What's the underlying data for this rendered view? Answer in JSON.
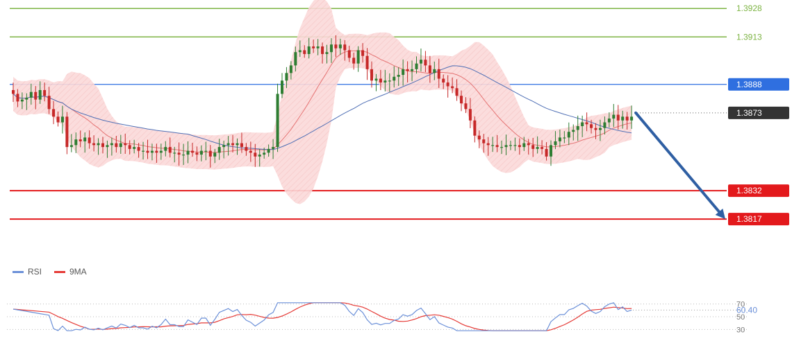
{
  "chart_data": [
    {
      "type": "candlestick",
      "title": "",
      "ylim": [
        1.3799,
        1.3931
      ],
      "grid": false,
      "current_price": {
        "value": 1.3873,
        "label": "1.3873",
        "color": "#333333"
      },
      "levels": [
        {
          "value": 1.3928,
          "label": "1.3928",
          "kind": "target",
          "color": "#7cb342"
        },
        {
          "value": 1.3913,
          "label": "1.3913",
          "kind": "target",
          "color": "#7cb342"
        },
        {
          "value": 1.3888,
          "label": "1.3888",
          "kind": "pivot",
          "color": "#2f6fe0"
        },
        {
          "value": 1.3832,
          "label": "1.3832",
          "kind": "support",
          "color": "#e3191c"
        },
        {
          "value": 1.3817,
          "label": "1.3817",
          "kind": "support",
          "color": "#e3191c"
        }
      ],
      "forecast_arrow": {
        "from": 1.3873,
        "to": 1.3817,
        "direction": "down",
        "color": "#2f5fa3"
      },
      "bollinger_bands": {
        "color": "#f6c4c4"
      },
      "moving_averages": [
        {
          "color": "#e57373"
        },
        {
          "color": "#4f6fb5"
        }
      ],
      "candle_colors": {
        "up": "#2e7d32",
        "down": "#c62828"
      },
      "closes": [
        1.3883,
        1.3879,
        1.388,
        1.3881,
        1.3884,
        1.388,
        1.3885,
        1.3882,
        1.3875,
        1.3871,
        1.3868,
        1.3871,
        1.3855,
        1.3856,
        1.3859,
        1.3858,
        1.386,
        1.3857,
        1.3856,
        1.3857,
        1.3855,
        1.3856,
        1.3857,
        1.3855,
        1.3857,
        1.3856,
        1.3854,
        1.3855,
        1.3853,
        1.3853,
        1.3852,
        1.3853,
        1.3852,
        1.3853,
        1.3855,
        1.3852,
        1.3852,
        1.3851,
        1.3851,
        1.3853,
        1.3852,
        1.3851,
        1.3853,
        1.3853,
        1.385,
        1.3852,
        1.3855,
        1.3856,
        1.3857,
        1.3856,
        1.3857,
        1.3855,
        1.3853,
        1.3852,
        1.385,
        1.3851,
        1.3852,
        1.3854,
        1.3855,
        1.3883,
        1.389,
        1.3894,
        1.3898,
        1.3905,
        1.3906,
        1.3904,
        1.3908,
        1.3907,
        1.3908,
        1.3904,
        1.3905,
        1.3909,
        1.3907,
        1.3909,
        1.3906,
        1.3902,
        1.3899,
        1.3906,
        1.3903,
        1.3896,
        1.389,
        1.3891,
        1.3889,
        1.389,
        1.389,
        1.3892,
        1.3893,
        1.3896,
        1.3895,
        1.3896,
        1.3899,
        1.3901,
        1.3898,
        1.3894,
        1.3896,
        1.3891,
        1.3889,
        1.3887,
        1.3886,
        1.3882,
        1.3878,
        1.3875,
        1.3869,
        1.3861,
        1.3859,
        1.3857,
        1.3856,
        1.3856,
        1.3855,
        1.3855,
        1.3856,
        1.3856,
        1.3856,
        1.3855,
        1.3857,
        1.3856,
        1.3854,
        1.3855,
        1.3854,
        1.385,
        1.3856,
        1.3858,
        1.386,
        1.386,
        1.3863,
        1.3864,
        1.3866,
        1.3868,
        1.3867,
        1.3865,
        1.3864,
        1.3865,
        1.3868,
        1.387,
        1.3872,
        1.3869,
        1.3871,
        1.3869,
        1.3871
      ]
    },
    {
      "type": "line",
      "title": "",
      "legend": [
        {
          "name": "RSI",
          "color": "#6a8fd8"
        },
        {
          "name": "9MA",
          "color": "#e53935"
        }
      ],
      "ylim": [
        25,
        75
      ],
      "y_ticks": [
        {
          "value": 70,
          "label": "70"
        },
        {
          "value": 50,
          "label": "50"
        },
        {
          "value": 30,
          "label": "30"
        }
      ],
      "current_value": {
        "value": 60.4,
        "label": "60.40"
      },
      "rsi_color": "#6a8fd8",
      "ma_color": "#e53935"
    }
  ]
}
